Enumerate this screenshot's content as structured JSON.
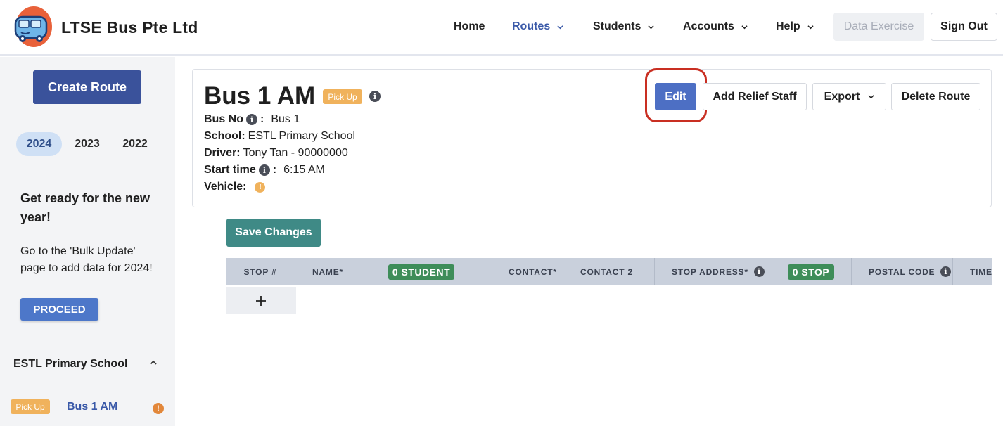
{
  "header": {
    "brand": "LTSE Bus Pte Ltd",
    "nav": [
      {
        "label": "Home",
        "dropdown": false
      },
      {
        "label": "Routes",
        "dropdown": true,
        "active": true
      },
      {
        "label": "Students",
        "dropdown": true
      },
      {
        "label": "Accounts",
        "dropdown": true
      },
      {
        "label": "Help",
        "dropdown": true
      }
    ],
    "data_exercise": "Data Exercise",
    "sign_out": "Sign Out"
  },
  "sidebar": {
    "create_route": "Create Route",
    "years": [
      "2024",
      "2023",
      "2022"
    ],
    "active_year": "2024",
    "promo_title": "Get ready for the new year!",
    "promo_text": "Go to the 'Bulk Update' page to add data for 2024!",
    "proceed": "PROCEED",
    "school": "ESTL Primary School",
    "routes": [
      {
        "badge": "Pick Up",
        "name": "Bus 1 AM",
        "warning": "!"
      }
    ]
  },
  "route": {
    "title": "Bus 1 AM",
    "badge": "Pick Up",
    "bus_no_label": "Bus No",
    "bus_no": "Bus 1",
    "school_label": "School:",
    "school": "ESTL Primary School",
    "driver_label": "Driver:",
    "driver": "Tony Tan - 90000000",
    "start_time_label": "Start time",
    "start_time": "6:15 AM",
    "vehicle_label": "Vehicle:",
    "vehicle_warning": "!"
  },
  "actions": {
    "edit": "Edit",
    "add_relief": "Add Relief Staff",
    "export": "Export",
    "delete": "Delete Route"
  },
  "save_changes": "Save Changes",
  "table": {
    "columns": [
      "STOP #",
      "NAME*",
      "CONTACT*",
      "CONTACT 2",
      "STOP ADDRESS*",
      "POSTAL CODE",
      "TIME"
    ],
    "student_count": "0 STUDENT",
    "stop_count": "0 STOP",
    "add_row": "+"
  },
  "colors": {
    "primary": "#3a529b",
    "accent_blue": "#4d6fc4",
    "pickup_badge": "#f0b25c",
    "save_green": "#3f8a86",
    "count_green": "#3e8d59",
    "highlight_red": "#c92f22"
  }
}
